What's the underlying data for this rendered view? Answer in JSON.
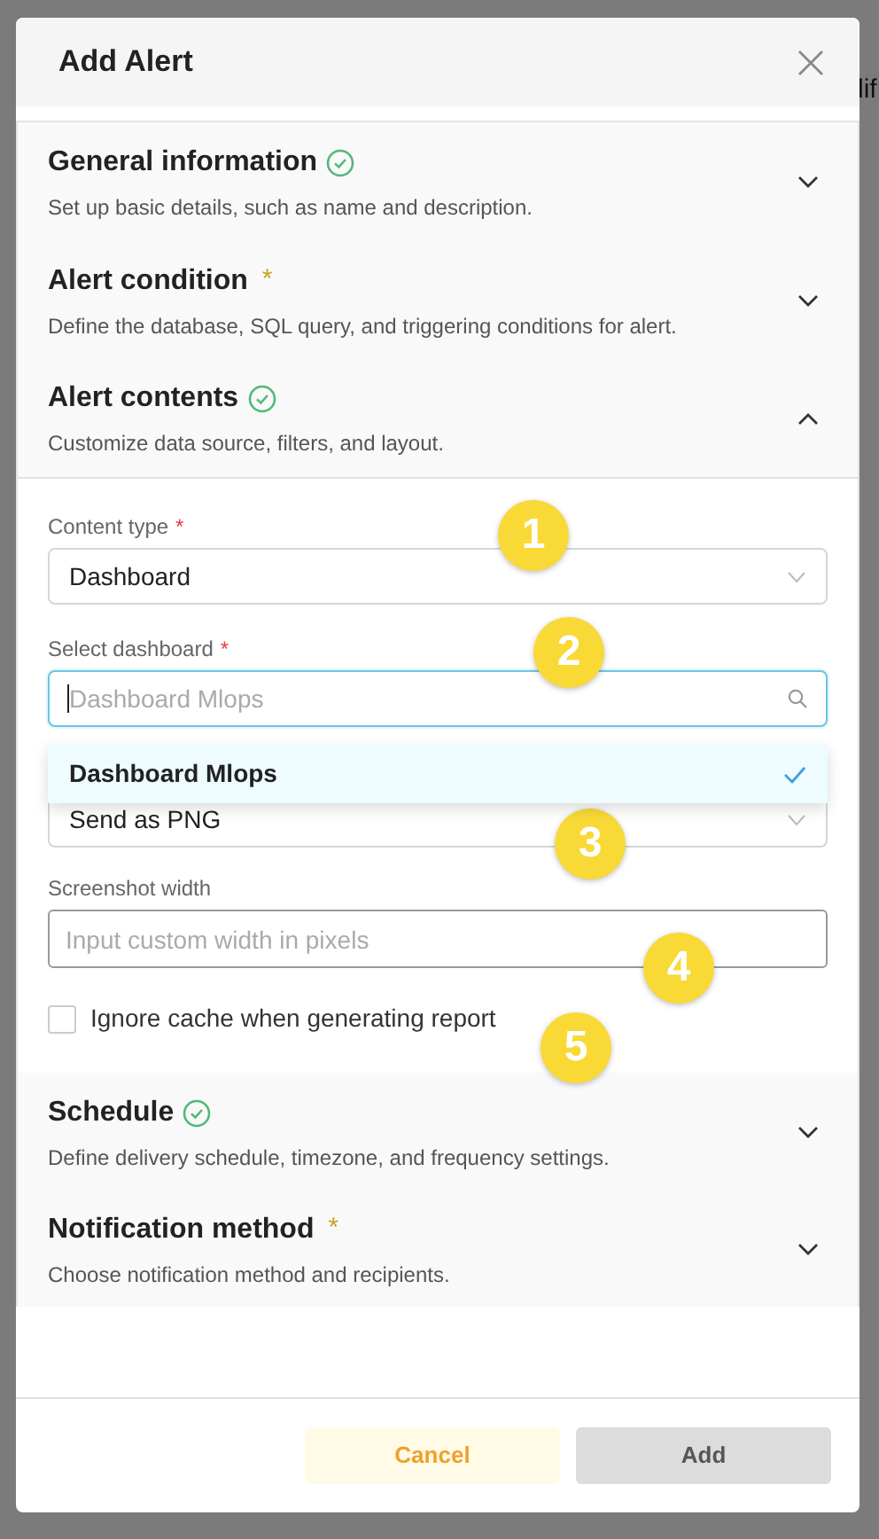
{
  "background": {
    "text": "lif"
  },
  "dialog": {
    "title": "Add Alert"
  },
  "sections": [
    {
      "title": "General information",
      "description": "Set up basic details, such as name and description.",
      "complete": true,
      "expanded": false
    },
    {
      "title": "Alert condition",
      "marker": "*",
      "description": "Define the database, SQL query, and triggering conditions for alert.",
      "complete": false,
      "expanded": false
    },
    {
      "title": "Alert contents",
      "description": "Customize data source, filters, and layout.",
      "complete": true,
      "expanded": true
    },
    {
      "title": "Schedule",
      "description": "Define delivery schedule, timezone, and frequency settings.",
      "complete": true,
      "expanded": false
    },
    {
      "title": "Notification method",
      "marker": "*",
      "description": "Choose notification method and recipients.",
      "complete": false,
      "expanded": false
    }
  ],
  "form": [
    {
      "kind": "select",
      "label": "Content type",
      "required_marker": "*",
      "value": "Dashboard"
    },
    {
      "kind": "search",
      "label": "Select dashboard",
      "required_marker": "*",
      "placeholder": "Dashboard Mlops",
      "focused": true
    },
    {
      "kind": "select",
      "value": "Send as PNG"
    },
    {
      "kind": "input",
      "label": "Screenshot width",
      "placeholder": "Input custom width in pixels"
    },
    {
      "kind": "checkbox",
      "label": "Ignore cache when generating report",
      "checked": false
    }
  ],
  "dropdown": {
    "options": [
      {
        "label": "Dashboard Mlops",
        "selected": true
      }
    ]
  },
  "buttons": [
    {
      "label": "Cancel",
      "kind": "secondary"
    },
    {
      "label": "Add",
      "kind": "primary",
      "disabled": true
    }
  ],
  "annotations": [
    "1",
    "2",
    "3",
    "4",
    "5"
  ]
}
